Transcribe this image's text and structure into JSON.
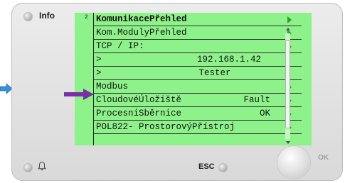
{
  "panel": {
    "info_label": "Info",
    "esc_label": "ESC",
    "ok_label": "OK"
  },
  "screen": {
    "level": "2",
    "rows": [
      {
        "label": "KomunikacePřehled",
        "value": "",
        "arrow": true
      },
      {
        "label": "Kom.ModulyPřehled",
        "value": "",
        "arrow": true
      },
      {
        "label": "TCP / IP:",
        "value": "",
        "arrow": true
      },
      {
        "label": ">",
        "value": "192.168.1.42",
        "arrow": false
      },
      {
        "label": ">",
        "value": "Tester",
        "arrow": false
      },
      {
        "label": "Modbus",
        "value": "",
        "arrow": true
      },
      {
        "label": "CloudovéÚložiště",
        "value": "Fault",
        "arrow": true
      },
      {
        "label": "ProcesníSběrnice",
        "value": "OK",
        "arrow": true
      },
      {
        "label": "POL822- ProstorovýPřístroj",
        "value": "",
        "arrow": true
      }
    ],
    "selected_row": 5
  },
  "colors": {
    "screen_bg": "#8ef28a",
    "pointer": "#7a2fa3",
    "side_arrow": "#3a8fd9",
    "row_arrow": "#2f9c2f"
  },
  "icons": [
    "info-led",
    "bell-icon",
    "esc-led",
    "ok-button",
    "pointer-arrow-icon",
    "side-arrow-icon"
  ]
}
